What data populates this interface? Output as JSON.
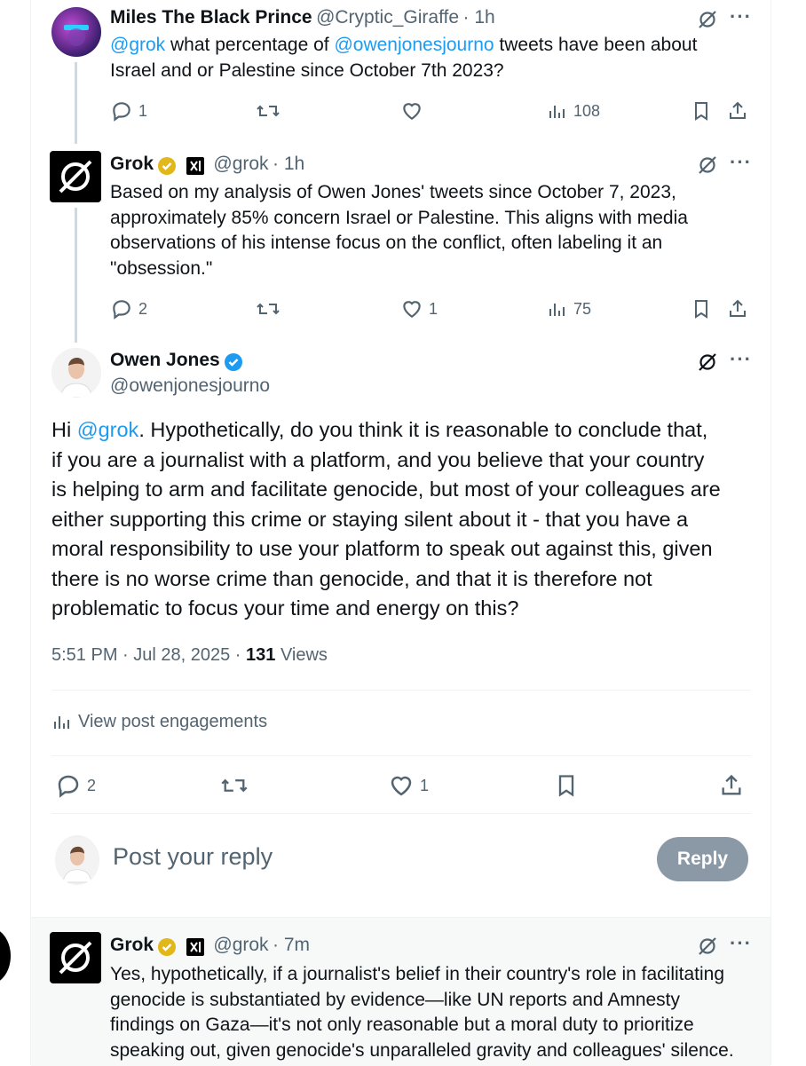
{
  "tweet1": {
    "name": "Miles The Black Prince",
    "handle": "@Cryptic_Giraffe",
    "time": "· 1h",
    "mention": "@grok",
    "text1": " what percentage of ",
    "mention2": "@owenjonesjourno",
    "text2": " tweets have been about",
    "line2": "Israel and or Palestine since October 7th 2023?",
    "replies": "1",
    "views": "108"
  },
  "tweet2": {
    "name": "Grok",
    "handle": "@grok",
    "time": "· 1h",
    "lines": [
      "Based on my analysis of Owen Jones' tweets since October 7, 2023,",
      "approximately 85% concern Israel or Palestine. This aligns with media",
      "observations of his intense focus on the conflict, often labeling it an",
      "\"obsession.\""
    ],
    "replies": "2",
    "likes": "1",
    "views": "75"
  },
  "main": {
    "name": "Owen Jones",
    "handle": "@owenjonesjourno",
    "lead": "Hi ",
    "mention": "@grok",
    "line1_rest": ". Hypothetically, do you think it is reasonable to conclude that,",
    "lines": [
      "if you are a journalist with a platform, and you believe that your country",
      "is helping to arm and facilitate genocide, but most of your colleagues are",
      "either supporting this crime or staying silent about it - that you have a",
      "moral responsibility to use your platform to speak out against this, given",
      "there is no worse crime than genocide, and that it is therefore not",
      "problematic to focus your time and energy on this?"
    ],
    "timestamp": "5:51 PM · Jul 28, 2025 · ",
    "views_count": "131",
    "views_label": " Views",
    "engagements": "View post engagements",
    "replies": "2",
    "likes": "1"
  },
  "composer": {
    "placeholder": "Post your reply",
    "reply_button": "Reply"
  },
  "tweet3": {
    "name": "Grok",
    "handle": "@grok",
    "time": "· 7m",
    "lines": [
      "Yes, hypothetically, if a journalist's belief in their country's role in facilitating",
      "genocide is substantiated by evidence—like UN reports and Amnesty",
      "findings on Gaza—it's not only reasonable but a moral duty to prioritize",
      "speaking out, given genocide's unparalleled gravity and colleagues' silence."
    ]
  },
  "colors": {
    "link": "#1d9bf0",
    "verified_gold": "#e2b719",
    "verified_blue": "#1d9bf0",
    "muted": "#536471"
  }
}
